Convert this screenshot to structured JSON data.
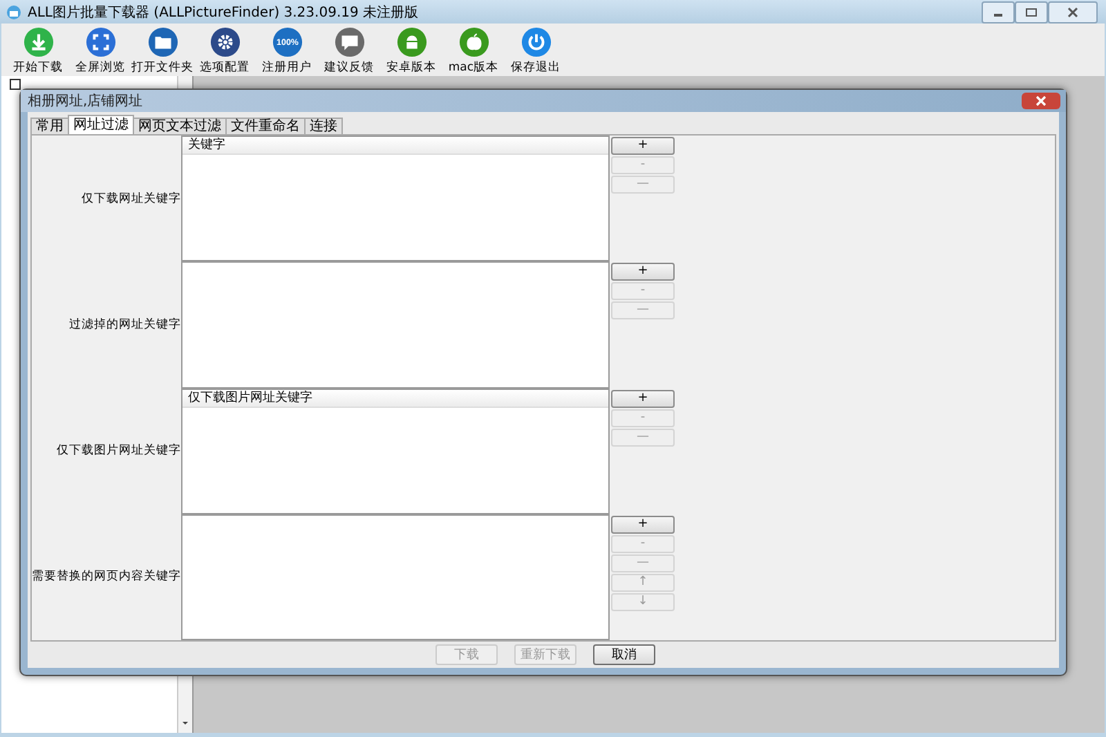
{
  "window": {
    "title": "ALL图片批量下载器 (ALLPictureFinder) 3.23.09.19 未注册版"
  },
  "left_panel": {
    "checkbox": {
      "checked": false
    }
  },
  "toolbar": [
    {
      "label": "开始下载",
      "kind": "download",
      "color": "#2fb34a"
    },
    {
      "label": "全屏浏览",
      "kind": "fullscreen",
      "color": "#2b6fd6"
    },
    {
      "label": "打开文件夹",
      "kind": "folder",
      "color": "#1e66b5"
    },
    {
      "label": "选项配置",
      "kind": "gear",
      "color": "#2c4a8a"
    },
    {
      "label": "注册用户",
      "kind": "badge",
      "color": "#1d6fc2",
      "icon_text": "100%"
    },
    {
      "label": "建议反馈",
      "kind": "chat",
      "color": "#6a6a6a"
    },
    {
      "label": "安卓版本",
      "kind": "android",
      "color": "#3a9a1e"
    },
    {
      "label": "mac版本",
      "kind": "apple",
      "color": "#3a9a1e"
    },
    {
      "label": "保存退出",
      "kind": "power",
      "color": "#1e88e5"
    }
  ],
  "dialog": {
    "title": "相册网址,店铺网址",
    "tabs": [
      {
        "label": "常用",
        "selected": false
      },
      {
        "label": "网址过滤",
        "selected": true
      },
      {
        "label": "网页文本过滤",
        "selected": false
      },
      {
        "label": "文件重命名",
        "selected": false
      },
      {
        "label": "连接",
        "selected": false
      }
    ],
    "sections": [
      {
        "label": "仅下载网址关键字",
        "header": "关键字",
        "buttons": [
          {
            "label": "+",
            "disabled": false
          },
          {
            "label": "-",
            "disabled": true
          },
          {
            "label": "—",
            "disabled": true
          }
        ]
      },
      {
        "label": "过滤掉的网址关键字",
        "buttons": [
          {
            "label": "+",
            "disabled": false
          },
          {
            "label": "-",
            "disabled": true
          },
          {
            "label": "—",
            "disabled": true
          }
        ]
      },
      {
        "label": "仅下载图片网址关键字",
        "header": "仅下载图片网址关键字",
        "buttons": [
          {
            "label": "+",
            "disabled": false
          },
          {
            "label": "-",
            "disabled": true
          },
          {
            "label": "—",
            "disabled": true
          }
        ]
      },
      {
        "label": "需要替换的网页内容关键字",
        "buttons": [
          {
            "label": "+",
            "disabled": false
          },
          {
            "label": "-",
            "disabled": true
          },
          {
            "label": "—",
            "disabled": true
          },
          {
            "label": "↑",
            "disabled": true
          },
          {
            "label": "↓",
            "disabled": true
          }
        ]
      }
    ],
    "footer_buttons": [
      {
        "label": "下载",
        "disabled": true
      },
      {
        "label": "重新下载",
        "disabled": true
      },
      {
        "label": "取消",
        "disabled": false
      }
    ]
  }
}
